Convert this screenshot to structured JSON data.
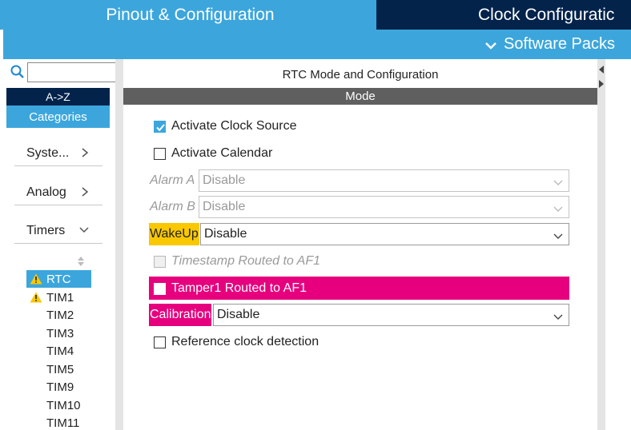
{
  "tabs": {
    "pinout": "Pinout & Configuration",
    "clock": "Clock Configuratic"
  },
  "subbar": {
    "software_packs": "Software Packs"
  },
  "sidebar": {
    "search_placeholder": "",
    "sort_az": "A->Z",
    "categories": "Categories",
    "category_items": [
      {
        "label": "Syste...",
        "state": "collapsed"
      },
      {
        "label": "Analog",
        "state": "collapsed"
      },
      {
        "label": "Timers",
        "state": "expanded"
      }
    ],
    "peripherals": [
      {
        "label": "RTC",
        "warning": true,
        "selected": true
      },
      {
        "label": "TIM1",
        "warning": true,
        "selected": false
      },
      {
        "label": "TIM2",
        "warning": false,
        "selected": false
      },
      {
        "label": "TIM3",
        "warning": false,
        "selected": false
      },
      {
        "label": "TIM4",
        "warning": false,
        "selected": false
      },
      {
        "label": "TIM5",
        "warning": false,
        "selected": false
      },
      {
        "label": "TIM9",
        "warning": false,
        "selected": false
      },
      {
        "label": "TIM10",
        "warning": false,
        "selected": false
      },
      {
        "label": "TIM11",
        "warning": false,
        "selected": false
      }
    ]
  },
  "main": {
    "title": "RTC Mode and Configuration",
    "mode_header": "Mode",
    "activate_clock_source": {
      "label": "Activate Clock Source",
      "checked": true
    },
    "activate_calendar": {
      "label": "Activate Calendar",
      "checked": false
    },
    "alarm_a": {
      "label": "Alarm A",
      "value": "Disable",
      "enabled": false
    },
    "alarm_b": {
      "label": "Alarm B",
      "value": "Disable",
      "enabled": false
    },
    "wakeup": {
      "label": "WakeUp",
      "value": "Disable",
      "enabled": true
    },
    "timestamp": {
      "label": "Timestamp Routed to AF1",
      "checked": false,
      "enabled": false
    },
    "tamper1": {
      "label": "Tamper1 Routed to AF1",
      "checked": false
    },
    "calibration": {
      "label": "Calibration",
      "value": "Disable"
    },
    "reference_clock": {
      "label": "Reference clock detection",
      "checked": false
    }
  },
  "colors": {
    "accent_blue": "#3ca6dc",
    "navy": "#03234b",
    "warning_yellow": "#f9c800",
    "error_pink": "#e6007e",
    "mode_bar_gray": "#5f5f5f"
  }
}
